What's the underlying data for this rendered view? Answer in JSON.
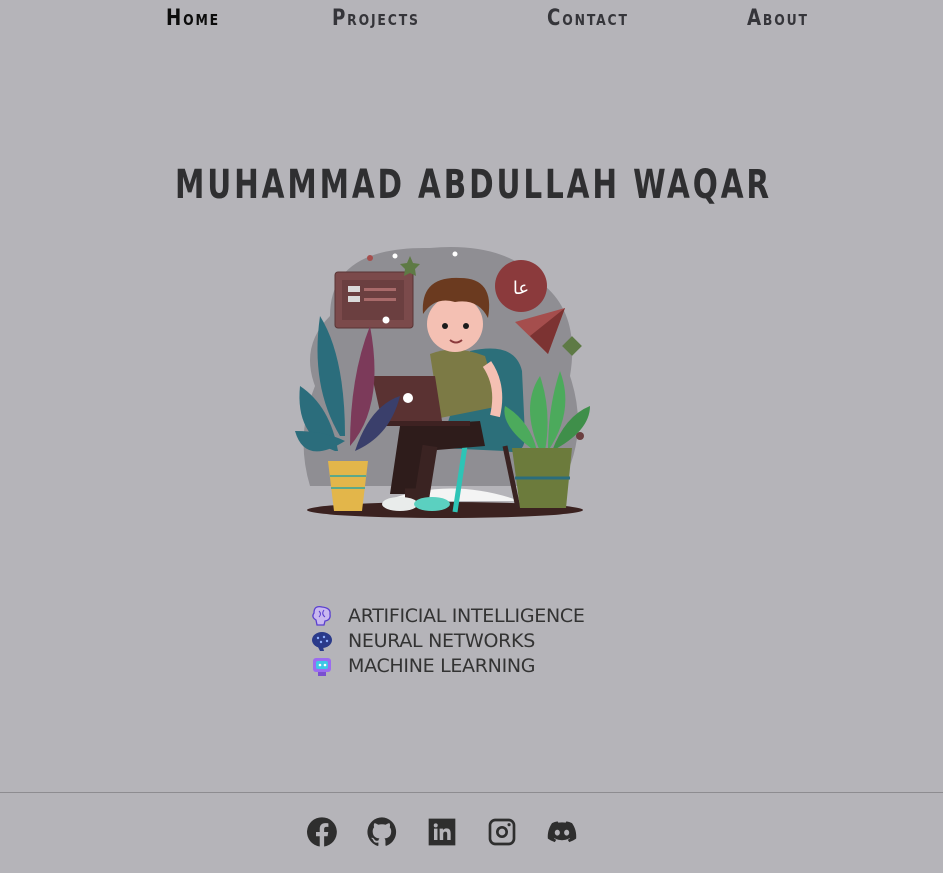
{
  "nav": {
    "home": "Home",
    "projects": "Projects",
    "contact": "Contact",
    "about": "About"
  },
  "hero": {
    "name": "MUHAMMAD ABDULLAH WAQAR",
    "illustration_icon": "person-with-laptop-illustration"
  },
  "skills": [
    {
      "label": "ARTIFICIAL INTELLIGENCE",
      "icon": "brain-icon"
    },
    {
      "label": "NEURAL NETWORKS",
      "icon": "neural-brain-icon"
    },
    {
      "label": "MACHINE LEARNING",
      "icon": "robot-icon"
    }
  ],
  "social": [
    {
      "icon": "facebook-icon"
    },
    {
      "icon": "github-icon"
    },
    {
      "icon": "linkedin-icon"
    },
    {
      "icon": "instagram-icon"
    },
    {
      "icon": "discord-icon"
    }
  ],
  "colors": {
    "background": "#b5b4b9",
    "text": "#2e2e2e"
  }
}
